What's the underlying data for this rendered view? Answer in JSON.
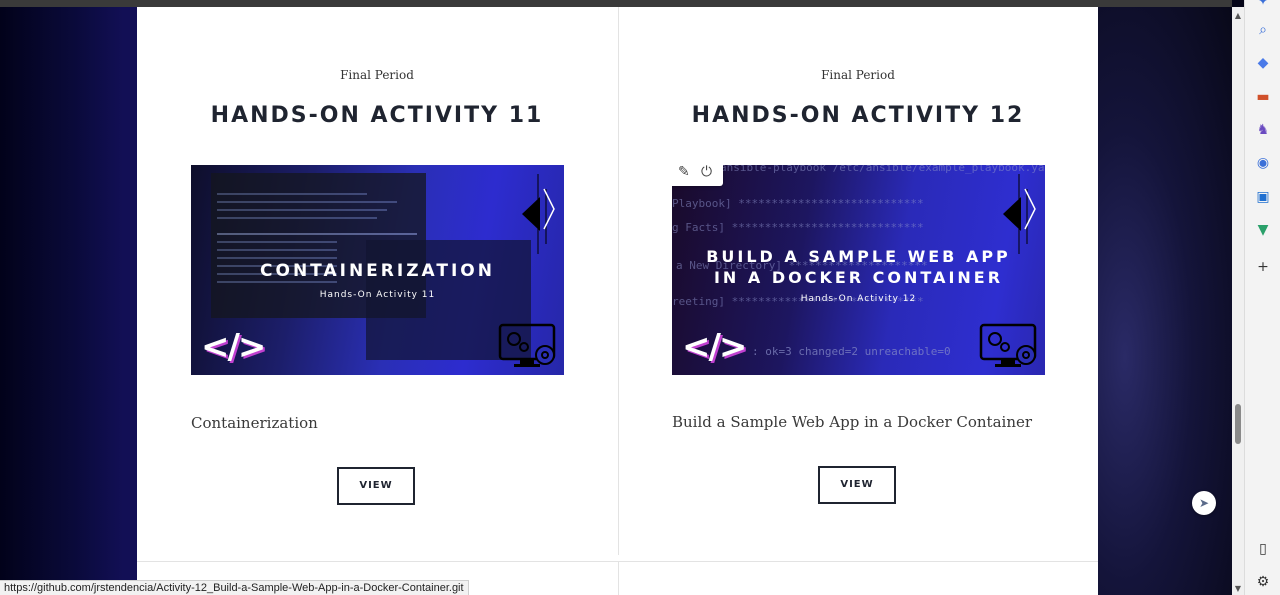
{
  "cards": [
    {
      "period": "Final Period",
      "title": "HANDS-ON ACTIVITY 11",
      "thumb_title": "CONTAINERIZATION",
      "thumb_sub": "Hands-On Activity 11",
      "caption": "Containerization",
      "button": "VIEW"
    },
    {
      "period": "Final Period",
      "title": "HANDS-ON ACTIVITY 12",
      "thumb_title_line1": "BUILD A SAMPLE WEB APP",
      "thumb_title_line2": "IN A DOCKER CONTAINER",
      "thumb_sub": "Hands-On Activity 12",
      "caption": "Build a Sample Web App in a Docker Container",
      "button": "VIEW",
      "ghost_lines": [
        "ansible-playbook /etc/ansible/example_playbook.yaml",
        "Playbook] ****************************",
        "g Facts] *****************************",
        "a New Directory] *********************",
        "reeting] *****************************",
        ": ok=3    changed=2    unreachable=0"
      ]
    }
  ],
  "status_url": "https://github.com/jrstendencia/Activity-12_Build-a-Sample-Web-App-in-a-Docker-Container.git",
  "code_glyph": "</>",
  "sidebar_icons": [
    "copilot-icon",
    "search-icon",
    "tag-icon",
    "briefcase-icon",
    "games-icon",
    "copilot-app-icon",
    "outlook-icon",
    "drive-icon",
    "add-icon",
    "sidebar-toggle-icon",
    "settings-icon"
  ],
  "colors": {
    "accent": "#1f2430",
    "thumb_blue": "#2d2ccf"
  }
}
